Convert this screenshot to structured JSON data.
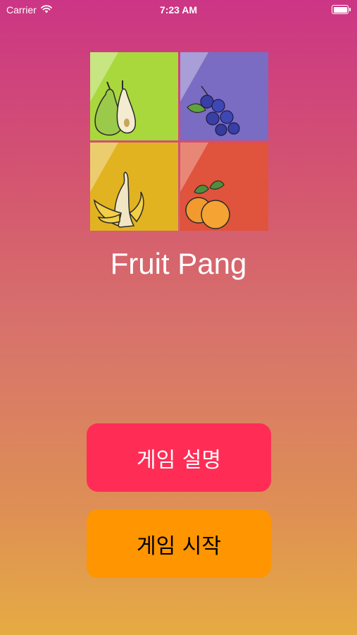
{
  "status_bar": {
    "carrier": "Carrier",
    "time": "7:23 AM",
    "battery_level": 1.0,
    "wifi_icon": "wifi-icon",
    "battery_icon": "battery-icon"
  },
  "logo": {
    "tiles": [
      {
        "fruit": "pear",
        "color": "#a9d83d"
      },
      {
        "fruit": "blueberries",
        "color": "#7a6bc3"
      },
      {
        "fruit": "banana",
        "color": "#e2b320"
      },
      {
        "fruit": "oranges",
        "color": "#e0533c"
      }
    ]
  },
  "app_title": "Fruit Pang",
  "buttons": {
    "how_to_play": "게임 설명",
    "start_game": "게임 시작"
  },
  "colors": {
    "how_to_play_bg": "#ff2d55",
    "start_game_bg": "#ff9500"
  }
}
